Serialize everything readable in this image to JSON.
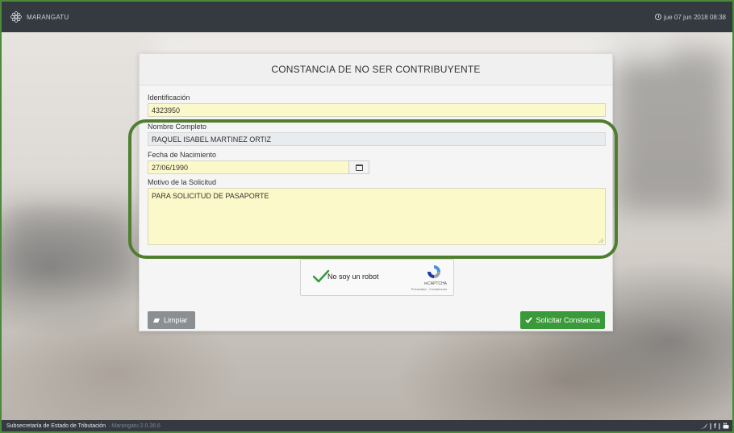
{
  "header": {
    "brand": "MARANGATU",
    "datetime": "jue 07 jun 2018 08:38",
    "logo_icon": "flower-logo-icon",
    "clock_icon": "clock-icon"
  },
  "form": {
    "title": "CONSTANCIA DE NO SER CONTRIBUYENTE",
    "identificacion": {
      "label": "Identificación",
      "value": "4323950"
    },
    "nombre": {
      "label": "Nombre Completo",
      "value": "RAQUEL ISABEL MARTINEZ  ORTIZ"
    },
    "fecha": {
      "label": "Fecha de Nacimiento",
      "value": "27/06/1990",
      "icon": "calendar-icon"
    },
    "motivo": {
      "label": "Motivo de la Solicitud",
      "value": "PARA SOLICITUD DE PASAPORTE"
    }
  },
  "captcha": {
    "label": "No soy un robot",
    "brand": "reCAPTCHA",
    "links": "Privacidad - Condiciones",
    "checked": true
  },
  "buttons": {
    "clear": "Limpiar",
    "submit": "Solicitar Constancia"
  },
  "footer": {
    "org": "Subsecretaría de Estado de Tributación",
    "version": "· Marangatu 2.0.36.6",
    "social_icons": [
      "twitter-icon",
      "facebook-icon",
      "youtube-icon"
    ],
    "social_sep": "|",
    "facebook": "f"
  },
  "colors": {
    "topbar": "#343a40",
    "input_bg": "#fbf9c9",
    "highlight": "#4e7e2e",
    "submit": "#3a9a3a",
    "clear": "#8a8f94"
  }
}
